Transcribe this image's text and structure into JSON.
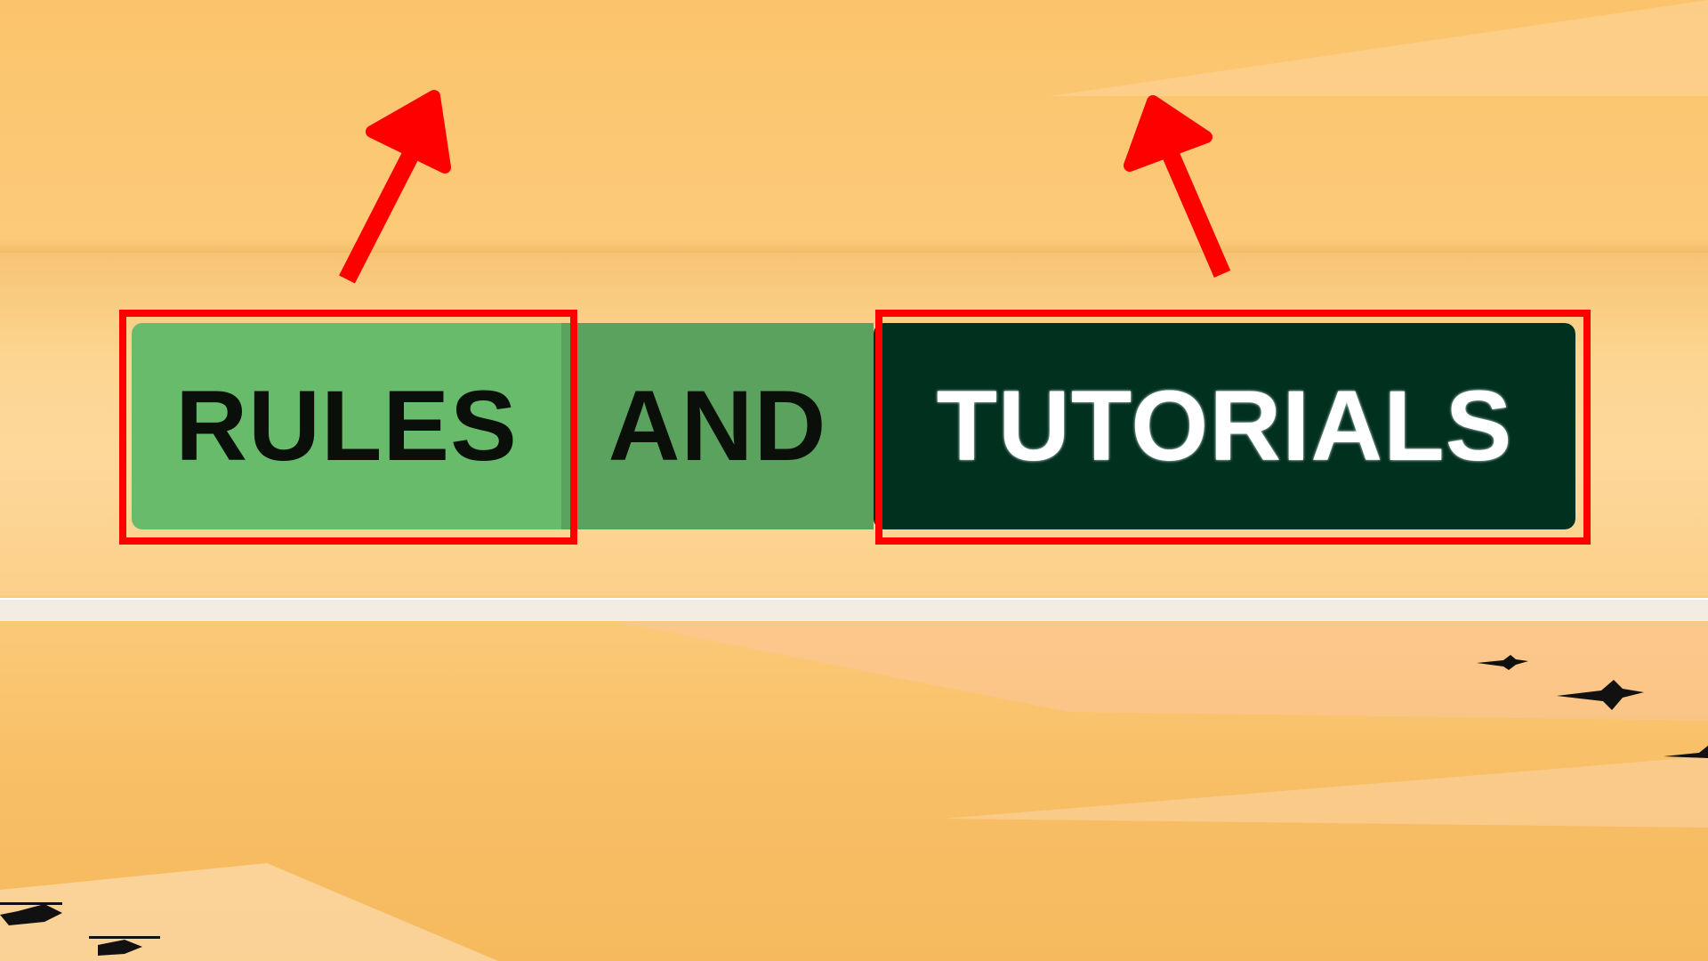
{
  "title": {
    "word_rules": "RULES",
    "word_and": "AND",
    "word_tutorials": "TUTORIALS"
  },
  "colors": {
    "sky_top": "#fbc46c",
    "sky_bottom": "#f6b95e",
    "rules_bg": "#68bb6a",
    "and_bg": "#5aa25e",
    "tutorials_bg": "#00301e",
    "tutorials_text": "#ffffff",
    "highlight": "#ff0000"
  },
  "annotations": {
    "highlight_boxes": [
      "rules-highlight-box",
      "tutorials-highlight-box"
    ],
    "arrows": [
      "arrow-to-rules",
      "arrow-to-tutorials"
    ]
  },
  "decorations": {
    "silhouettes": [
      "fighter-jet-icon",
      "helicopter-icon"
    ]
  }
}
